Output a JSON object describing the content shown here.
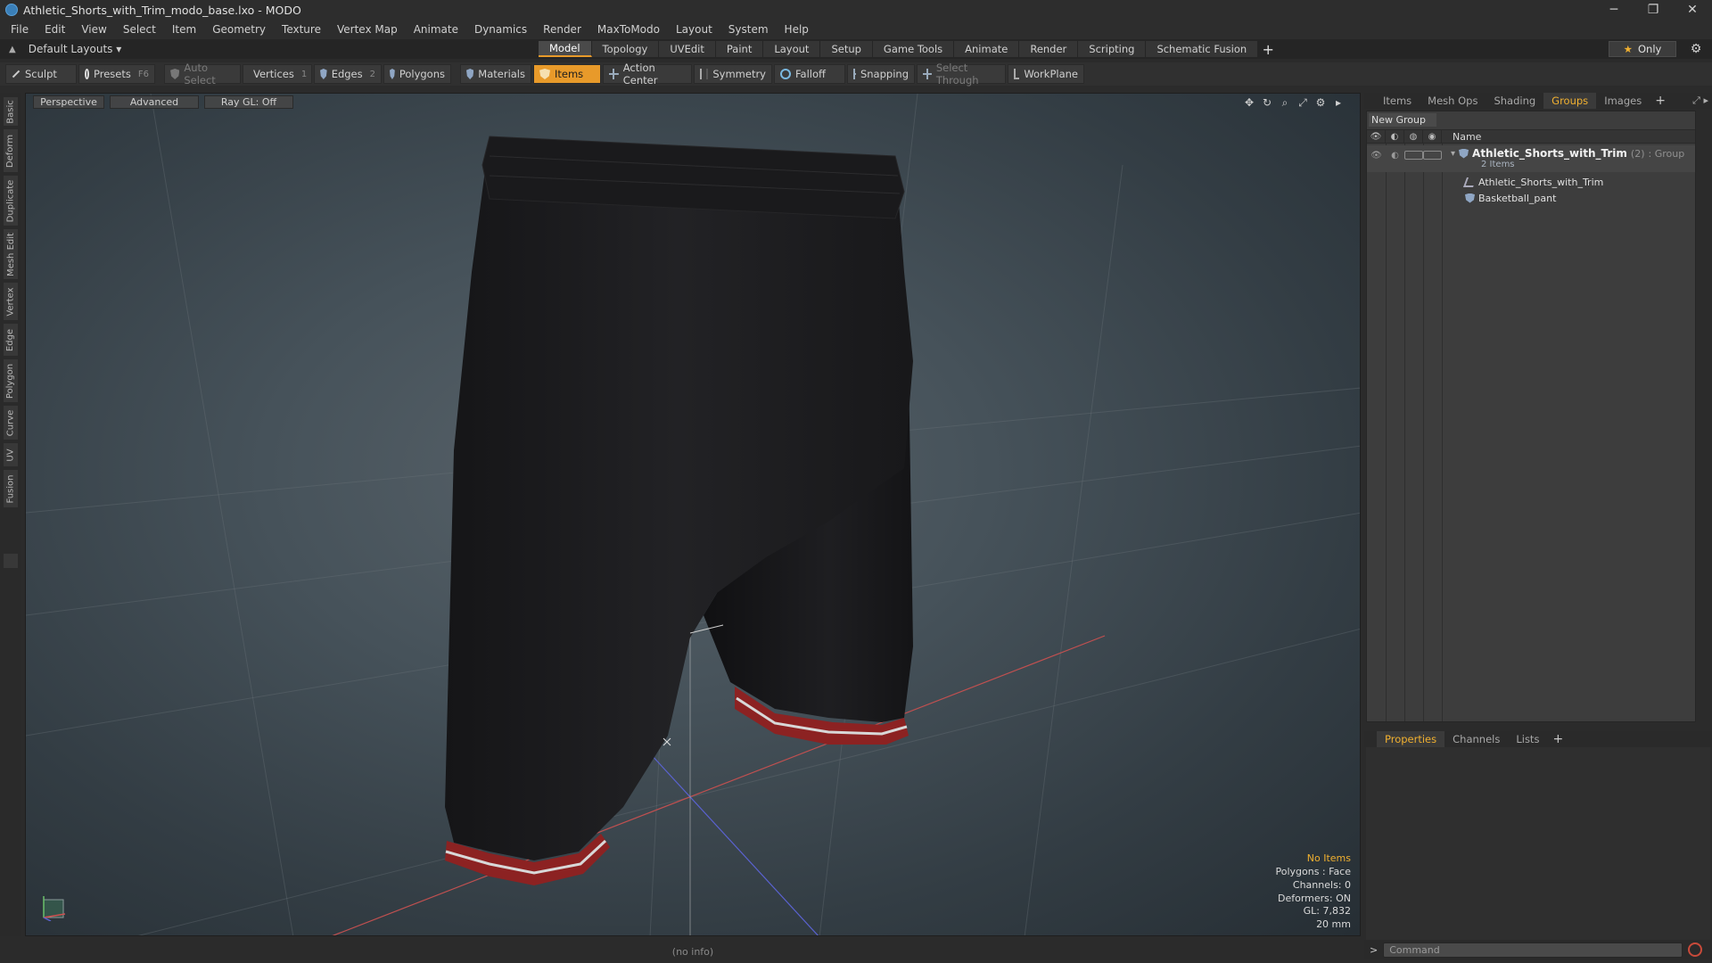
{
  "window": {
    "title": "Athletic_Shorts_with_Trim_modo_base.lxo - MODO",
    "minimize": "─",
    "restore": "❐",
    "close": "✕"
  },
  "menu": [
    "File",
    "Edit",
    "View",
    "Select",
    "Item",
    "Geometry",
    "Texture",
    "Vertex Map",
    "Animate",
    "Dynamics",
    "Render",
    "MaxToModo",
    "Layout",
    "System",
    "Help"
  ],
  "layout": {
    "selector": "Default Layouts ▾",
    "tabs": [
      "Model",
      "Topology",
      "UVEdit",
      "Paint",
      "Layout",
      "Setup",
      "Game Tools",
      "Animate",
      "Render",
      "Scripting",
      "Schematic Fusion"
    ],
    "active_tab": "Model",
    "add": "+",
    "only_label": "Only"
  },
  "toolbar": {
    "sculpt": "Sculpt",
    "presets": "Presets",
    "presets_key": "F6",
    "auto_select": "Auto Select",
    "vertices": "Vertices",
    "vertices_key": "1",
    "edges": "Edges",
    "edges_key": "2",
    "polygons": "Polygons",
    "materials": "Materials",
    "items": "Items",
    "action_center": "Action Center",
    "symmetry": "Symmetry",
    "falloff": "Falloff",
    "snapping": "Snapping",
    "select_through": "Select Through",
    "workplane": "WorkPlane"
  },
  "left_tabs": [
    "Basic",
    "Deform",
    "Duplicate",
    "Mesh Edit",
    "Vertex",
    "Edge",
    "Polygon",
    "Curve",
    "UV",
    "Fusion"
  ],
  "viewport": {
    "view": "Perspective",
    "shading": "Advanced",
    "raygl": "Ray GL: Off",
    "info": {
      "selection": "No Items",
      "polygons": "Polygons : Face",
      "channels": "Channels: 0",
      "deformers": "Deformers: ON",
      "gl": "GL: 7,832",
      "scale": "20 mm"
    }
  },
  "groups_panel": {
    "tabs": [
      "Items",
      "Mesh Ops",
      "Shading",
      "Groups",
      "Images"
    ],
    "active_tab": "Groups",
    "new_group": "New Group",
    "column_name": "Name",
    "group": {
      "name": "Athletic_Shorts_with_Trim",
      "count": "(2)",
      "type": ": Group",
      "subtitle": "2 Items"
    },
    "children": [
      "Athletic_Shorts_with_Trim",
      "Basketball_pant"
    ]
  },
  "properties_panel": {
    "tabs": [
      "Properties",
      "Channels",
      "Lists"
    ],
    "active_tab": "Properties"
  },
  "status": {
    "info": "(no info)"
  },
  "command": {
    "prompt": ">",
    "placeholder": "Command"
  },
  "colors": {
    "accent": "#e89a2a",
    "active_tab_text": "#f0b030",
    "shorts": "#1c1c1e",
    "trim_red": "#a82a2a",
    "trim_white": "#d8d8d8"
  }
}
